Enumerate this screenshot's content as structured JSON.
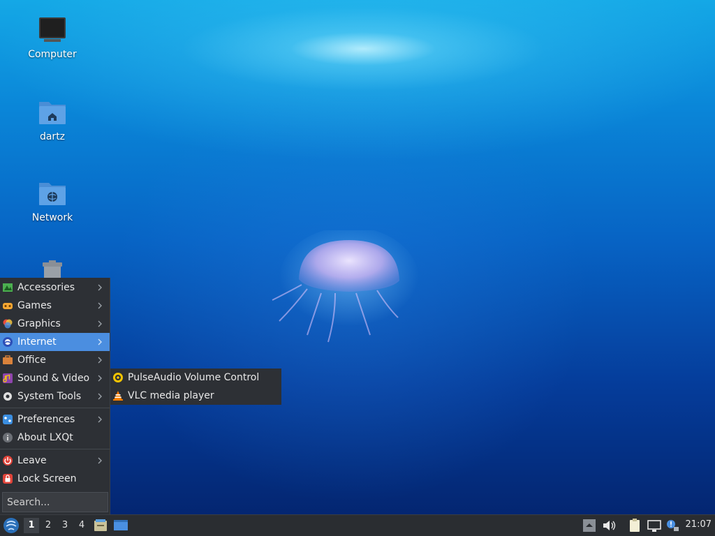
{
  "desktop": {
    "icons": [
      {
        "label": "Computer",
        "icon": "computer-icon"
      },
      {
        "label": "dartz",
        "icon": "home-folder-icon"
      },
      {
        "label": "Network",
        "icon": "network-folder-icon"
      },
      {
        "label": "",
        "icon": "trash-icon"
      }
    ]
  },
  "main_menu": {
    "items": [
      {
        "label": "Accessories",
        "icon": "accessories-icon",
        "submenu": true
      },
      {
        "label": "Games",
        "icon": "games-icon",
        "submenu": true
      },
      {
        "label": "Graphics",
        "icon": "graphics-icon",
        "submenu": true
      },
      {
        "label": "Internet",
        "icon": "internet-icon",
        "submenu": true,
        "highlighted": true
      },
      {
        "label": "Office",
        "icon": "office-icon",
        "submenu": true
      },
      {
        "label": "Sound & Video",
        "icon": "sound-video-icon",
        "submenu": true
      },
      {
        "label": "System Tools",
        "icon": "system-tools-icon",
        "submenu": true
      },
      {
        "label": "Preferences",
        "icon": "preferences-icon",
        "submenu": true
      },
      {
        "label": "About LXQt",
        "icon": "info-icon",
        "submenu": false
      },
      {
        "label": "Leave",
        "icon": "power-icon",
        "submenu": true
      },
      {
        "label": "Lock Screen",
        "icon": "lock-icon",
        "submenu": false
      }
    ],
    "search": {
      "placeholder": "Search..."
    }
  },
  "sub_menu": {
    "items": [
      {
        "label": "PulseAudio Volume Control",
        "icon": "pulseaudio-icon"
      },
      {
        "label": "VLC media player",
        "icon": "vlc-icon"
      }
    ]
  },
  "taskbar": {
    "workspaces": [
      "1",
      "2",
      "3",
      "4"
    ],
    "current_workspace": "1",
    "clock": "21:07"
  },
  "colors": {
    "menu_bg": "#2d3035",
    "highlight": "#4b8ee0",
    "taskbar_bg": "#2a2d31"
  }
}
